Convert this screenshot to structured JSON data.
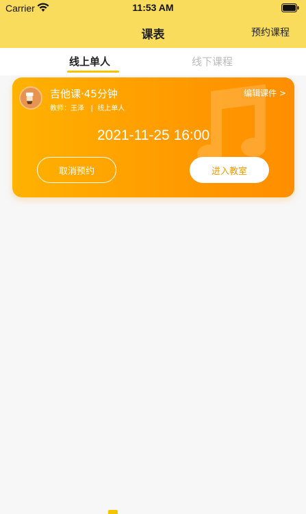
{
  "status_bar": {
    "carrier": "Carrier",
    "time": "11:53 AM"
  },
  "nav": {
    "title": "课表",
    "right_action": "预约课程"
  },
  "tabs": [
    {
      "label": "线上单人",
      "active": true
    },
    {
      "label": "线下课程",
      "active": false
    }
  ],
  "lesson": {
    "course_name": "吉他课·45分钟",
    "teacher_info": "教师：王泽   |  线上单人",
    "edit_label": "编辑课件 >",
    "datetime": "2021-11-25 16:00",
    "cancel_label": "取消预约",
    "enter_label": "进入教室"
  },
  "colors": {
    "header_bg": "#f9dc5c",
    "card_start": "#ffb200",
    "card_end": "#ff8e00",
    "accent": "#f5c400"
  }
}
